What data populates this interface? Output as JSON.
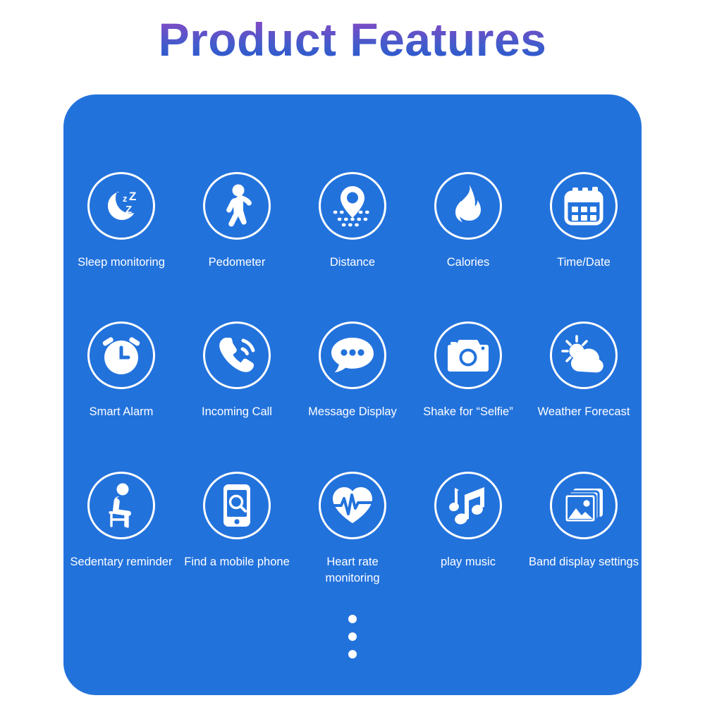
{
  "page": {
    "title": "Product Features",
    "title_gradient_from": "#9850c8",
    "title_gradient_to": "#1f56cf",
    "card_color": "#2272dc",
    "icon_color": "#ffffff",
    "label_color": "#ffffff"
  },
  "features": [
    {
      "label": "Sleep monitoring",
      "icon": "moon-zzz-icon"
    },
    {
      "label": "Pedometer",
      "icon": "walking-person-icon"
    },
    {
      "label": "Distance",
      "icon": "map-pin-route-icon"
    },
    {
      "label": "Calories",
      "icon": "flame-icon"
    },
    {
      "label": "Time/Date",
      "icon": "calendar-icon"
    },
    {
      "label": "Smart Alarm",
      "icon": "alarm-clock-icon"
    },
    {
      "label": "Incoming Call",
      "icon": "phone-ringing-icon"
    },
    {
      "label": "Message Display",
      "icon": "chat-bubble-dots-icon"
    },
    {
      "label": "Shake for “Selfie”",
      "icon": "camera-icon"
    },
    {
      "label": "Weather Forecast",
      "icon": "sun-cloud-icon"
    },
    {
      "label": "Sedentary reminder",
      "icon": "person-sitting-icon"
    },
    {
      "label": "Find a mobile phone",
      "icon": "phone-search-icon"
    },
    {
      "label": "Heart rate monitoring",
      "icon": "heart-pulse-icon"
    },
    {
      "label": "play music",
      "icon": "music-notes-icon"
    },
    {
      "label": "Band display settings",
      "icon": "photo-gallery-icon"
    }
  ],
  "more_indicator": {
    "icon": "vertical-ellipsis-icon",
    "dots": 3
  }
}
